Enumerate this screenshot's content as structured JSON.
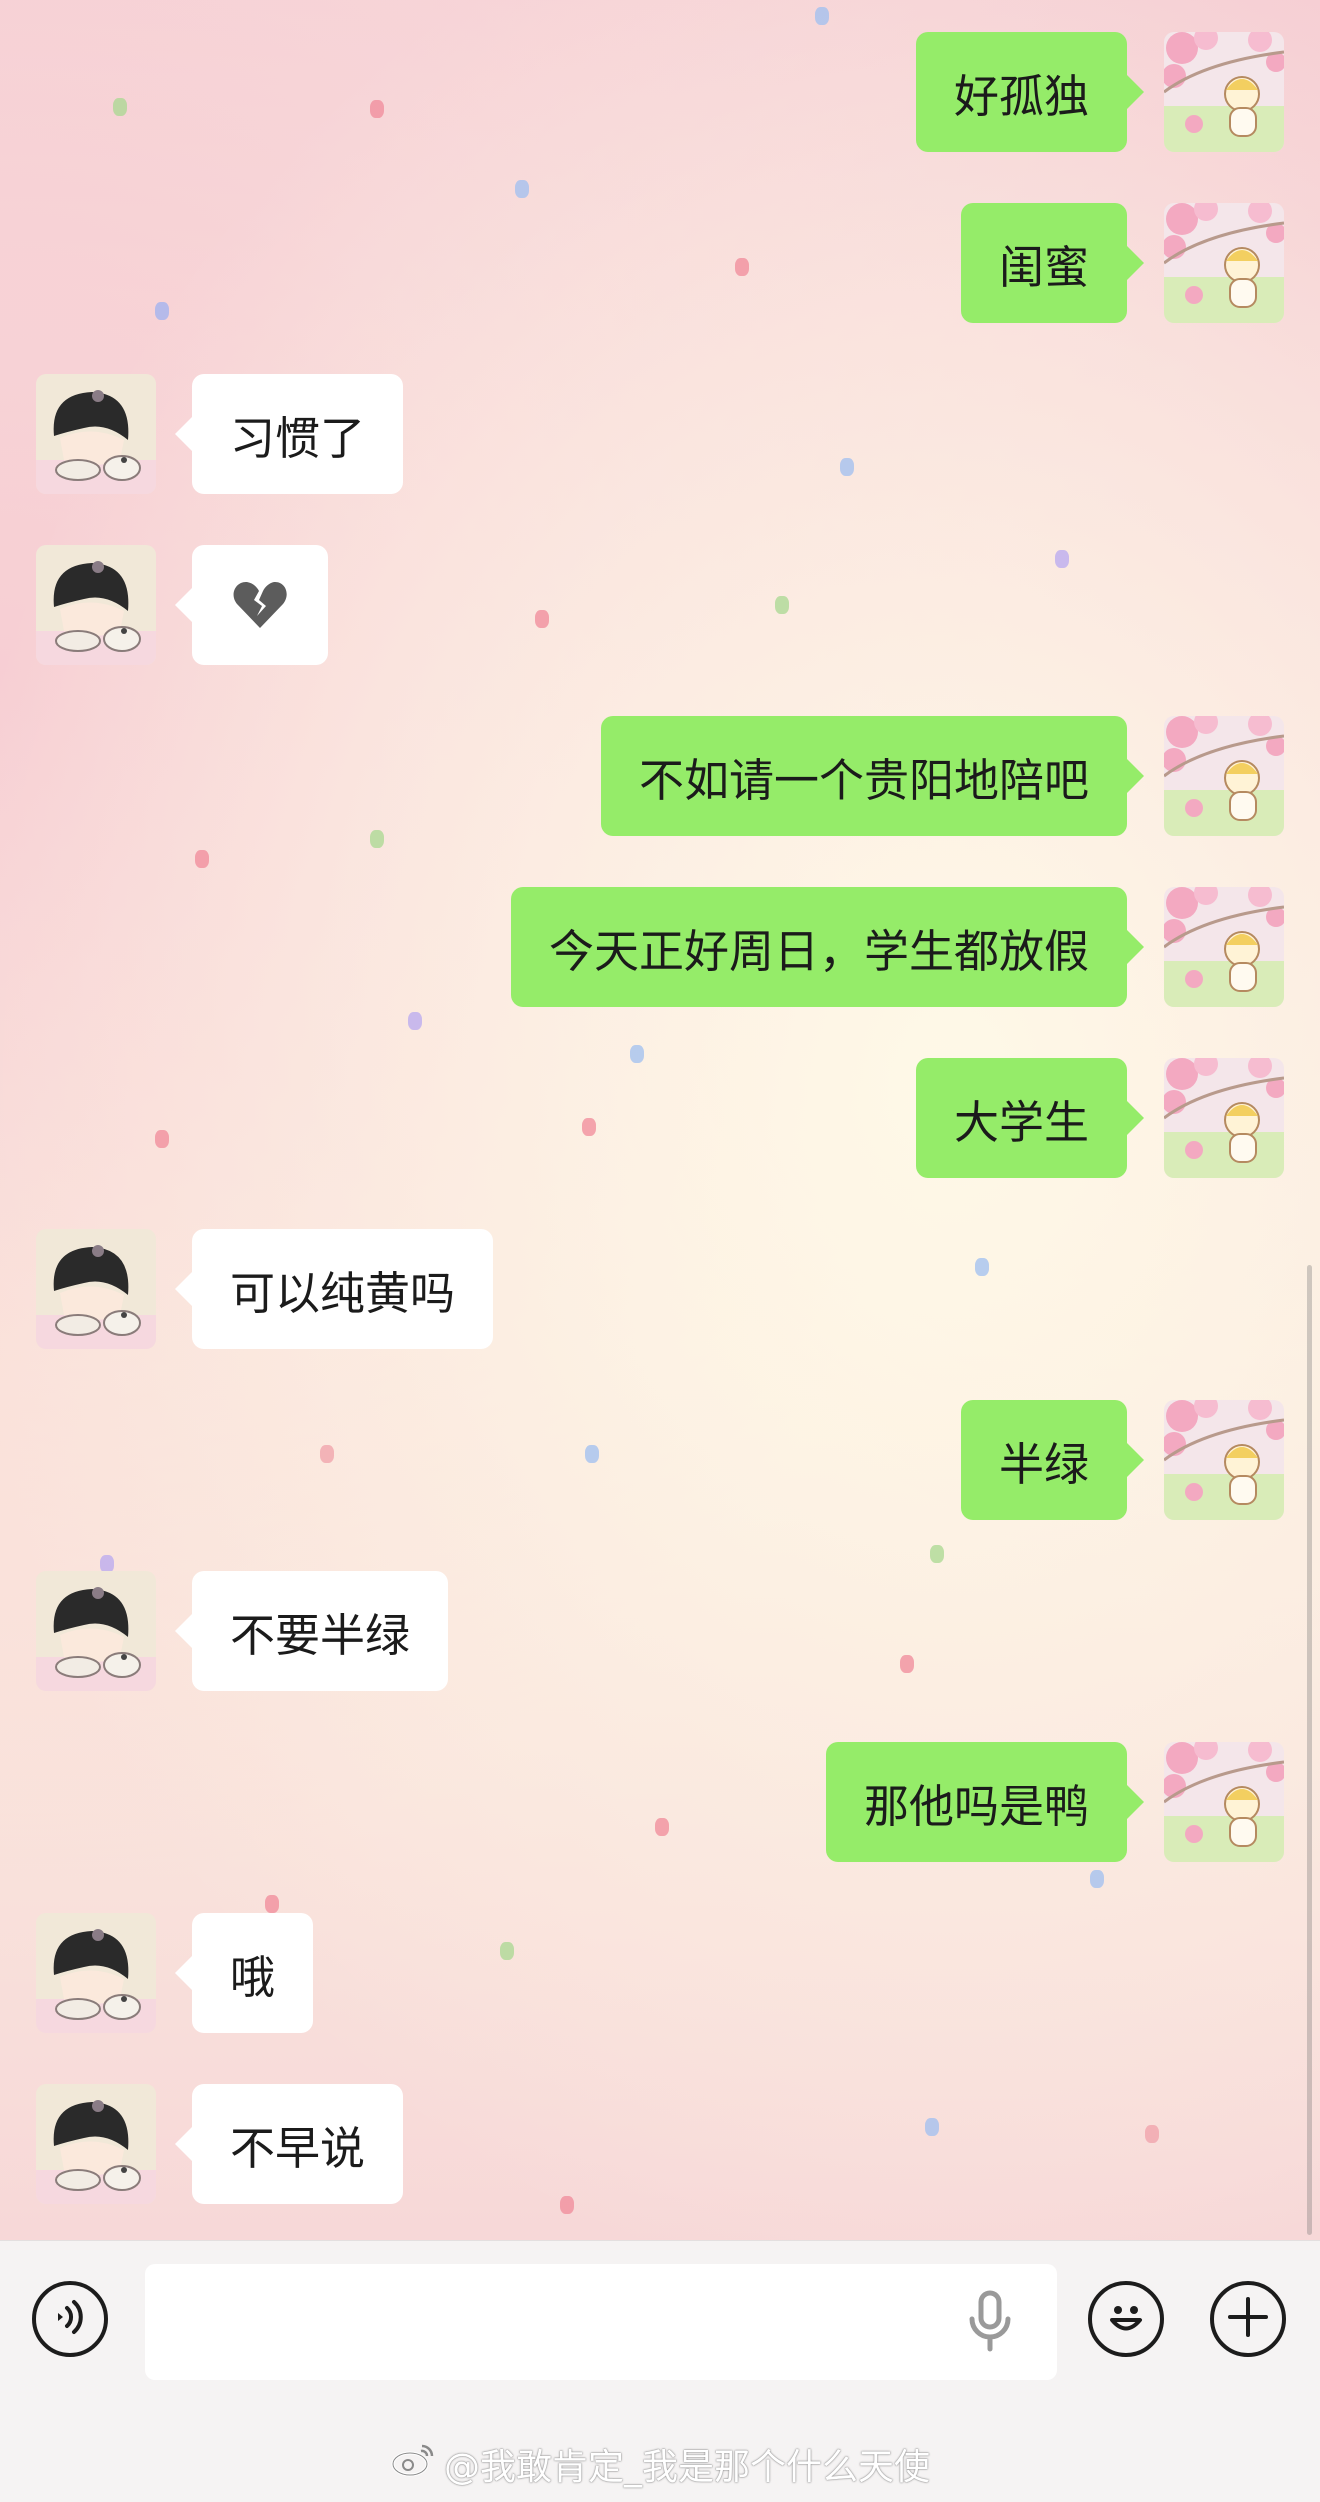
{
  "messages": [
    {
      "side": "right",
      "text": "好孤独"
    },
    {
      "side": "right",
      "text": "闺蜜"
    },
    {
      "side": "left",
      "text": "习惯了"
    },
    {
      "side": "left",
      "text": "",
      "emoji": "broken-heart-icon"
    },
    {
      "side": "right",
      "text": "不如请一个贵阳地陪吧"
    },
    {
      "side": "right",
      "text": "今天正好周日，学生都放假"
    },
    {
      "side": "right",
      "text": "大学生"
    },
    {
      "side": "left",
      "text": "可以纯黄吗"
    },
    {
      "side": "right",
      "text": "半绿"
    },
    {
      "side": "left",
      "text": "不要半绿"
    },
    {
      "side": "right",
      "text": "那他吗是鸭"
    },
    {
      "side": "left",
      "text": "哦"
    },
    {
      "side": "left",
      "text": "不早说"
    }
  ],
  "input_bar": {
    "text_value": "",
    "voice_icon": "voice-mode-icon",
    "mic_icon": "mic-icon",
    "emoji_icon": "emoji-icon",
    "plus_icon": "plus-icon"
  },
  "watermark": {
    "text": "@我敢肯定_我是那个什么天使",
    "icon": "weibo-icon"
  },
  "colors": {
    "sent_bubble": "#95ec69",
    "received_bubble": "#ffffff",
    "input_bar_bg": "#f5f3f3"
  }
}
